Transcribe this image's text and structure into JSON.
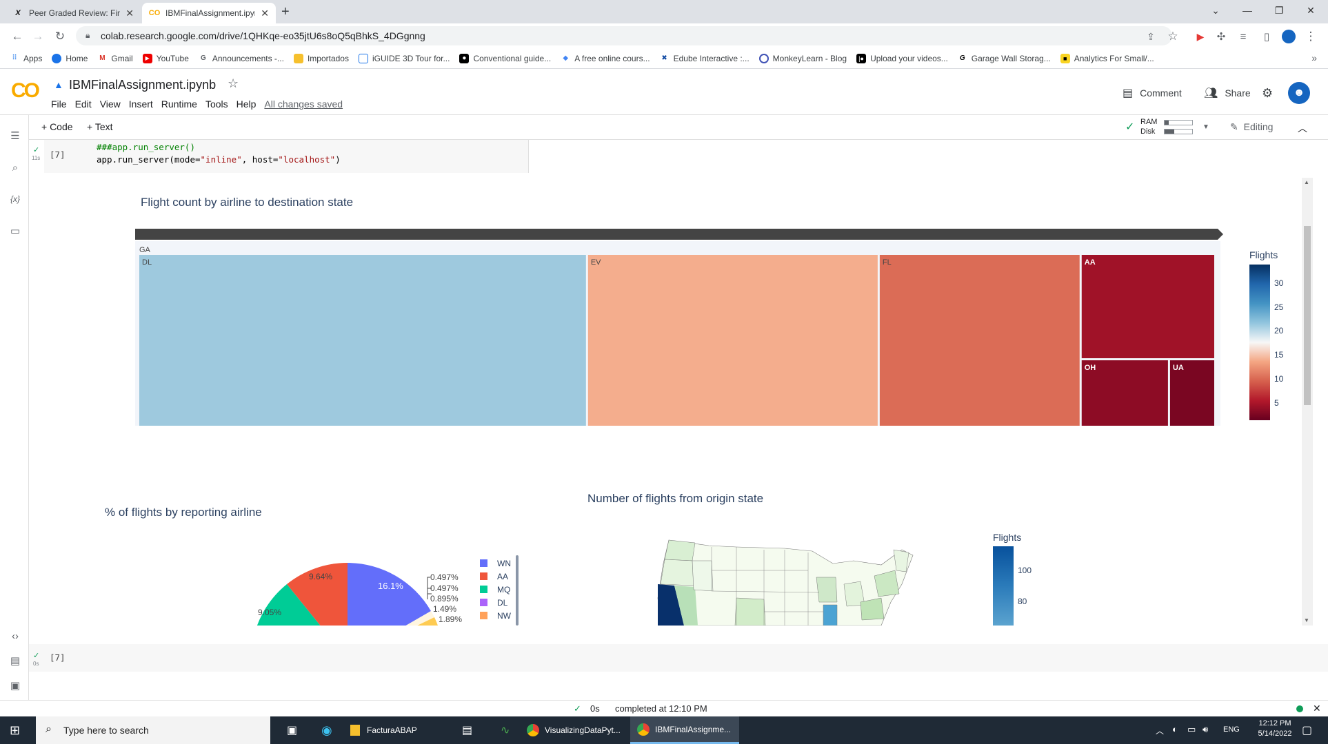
{
  "browser": {
    "tabs": [
      {
        "title": "Peer Graded Review: Final Assign",
        "icon": "X"
      },
      {
        "title": "IBMFinalAssignment.ipynb - Cola",
        "icon": "CO"
      }
    ],
    "url": "colab.research.google.com/drive/1QHKqe-eo35jtU6s8oQ5qBhkS_4DGgnng",
    "bookmarks": [
      "Apps",
      "Home",
      "Gmail",
      "YouTube",
      "Announcements -...",
      "Importados",
      "iGUIDE 3D Tour for...",
      "Conventional guide...",
      "A free online cours...",
      "Edube Interactive :...",
      "MonkeyLearn - Blog",
      "Upload your videos...",
      "Garage Wall Storag...",
      "Analytics For Small/..."
    ]
  },
  "colab": {
    "logo": "CO",
    "notebook_title": "IBMFinalAssignment.ipynb",
    "menu": [
      "File",
      "Edit",
      "View",
      "Insert",
      "Runtime",
      "Tools",
      "Help"
    ],
    "save_status": "All changes saved",
    "comment_label": "Comment",
    "share_label": "Share",
    "toolbar": {
      "code_label": "+ Code",
      "text_label": "+ Text",
      "ram_label": "RAM",
      "disk_label": "Disk",
      "editing_label": "Editing"
    }
  },
  "cell": {
    "exec_count": "[7]",
    "exec_time": "11s",
    "line1": "###app.run_server()",
    "line2_pre": "app.run_server(mode=",
    "line2_s1": "\"inline\"",
    "line2_mid": ", host=",
    "line2_s2": "\"localhost\"",
    "line2_post": ")"
  },
  "cell2": {
    "exec_count": "[7]",
    "exec_time": "0s"
  },
  "treemap": {
    "title": "Flight count by airline to destination state",
    "root_label": "GA",
    "colorbar_title": "Flights",
    "colorbar_ticks": [
      "30",
      "25",
      "20",
      "15",
      "10",
      "5"
    ]
  },
  "pie": {
    "title": "% of flights by reporting airline",
    "labels_inside": [
      "16.1%",
      "9.64%",
      "9.05%"
    ],
    "labels_outside": [
      "0.497%",
      "0.497%",
      "0.895%",
      "1.49%",
      "1.89%"
    ],
    "legend": [
      {
        "name": "WN",
        "color": "#636efa"
      },
      {
        "name": "AA",
        "color": "#ef553b"
      },
      {
        "name": "MQ",
        "color": "#00cc96"
      },
      {
        "name": "DL",
        "color": "#ab63fa"
      },
      {
        "name": "NW",
        "color": "#ffa15a"
      }
    ]
  },
  "map": {
    "title": "Number of flights from origin state",
    "colorbar_title": "Flights",
    "colorbar_ticks": [
      "100",
      "80"
    ]
  },
  "chart_data": [
    {
      "type": "treemap",
      "title": "Flight count by airline to destination state",
      "root": "GA",
      "categories": [
        "DL",
        "EV",
        "FL",
        "AA",
        "OH",
        "UA"
      ],
      "values": [
        20,
        13,
        9,
        3,
        2,
        1
      ],
      "colorscale": "RdBu",
      "colorbar_title": "Flights",
      "colorbar_ticks": [
        5,
        10,
        15,
        20,
        25,
        30
      ]
    },
    {
      "type": "pie",
      "title": "% of flights by reporting airline",
      "categories": [
        "WN",
        "AA",
        "MQ",
        "DL",
        "NW"
      ],
      "values": [
        16.1,
        9.64,
        9.05,
        null,
        null
      ],
      "small_slice_labels": [
        0.497,
        0.497,
        0.895,
        1.49,
        1.89
      ]
    },
    {
      "type": "choropleth",
      "title": "Number of flights from origin state",
      "colorbar_title": "Flights",
      "colorbar_ticks": [
        80,
        100
      ]
    }
  ],
  "status": {
    "check": "✓",
    "time": "0s",
    "text": "completed at 12:10 PM"
  },
  "taskbar": {
    "search_placeholder": "Type here to search",
    "apps": [
      "FacturaABAP",
      "VisualizingDataPyt...",
      "IBMFinalAssignme..."
    ],
    "lang": "ENG",
    "time": "12:12 PM",
    "date": "5/14/2022"
  }
}
